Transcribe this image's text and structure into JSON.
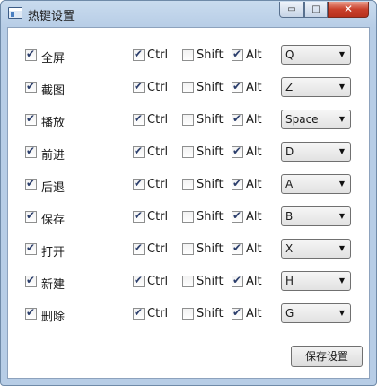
{
  "window": {
    "title": "热键设置",
    "minimize_glyph": "▭",
    "maximize_glyph": "□",
    "close_glyph": "✕"
  },
  "rows": [
    {
      "action": "全屏",
      "action_checked": true,
      "ctrl": true,
      "shift": false,
      "alt": true,
      "key": "Q"
    },
    {
      "action": "截图",
      "action_checked": true,
      "ctrl": true,
      "shift": false,
      "alt": true,
      "key": "Z"
    },
    {
      "action": "播放",
      "action_checked": true,
      "ctrl": true,
      "shift": false,
      "alt": true,
      "key": "Space"
    },
    {
      "action": "前进",
      "action_checked": true,
      "ctrl": true,
      "shift": false,
      "alt": true,
      "key": "D"
    },
    {
      "action": "后退",
      "action_checked": true,
      "ctrl": true,
      "shift": false,
      "alt": true,
      "key": "A"
    },
    {
      "action": "保存",
      "action_checked": true,
      "ctrl": true,
      "shift": false,
      "alt": true,
      "key": "B"
    },
    {
      "action": "打开",
      "action_checked": true,
      "ctrl": true,
      "shift": false,
      "alt": true,
      "key": "X"
    },
    {
      "action": "新建",
      "action_checked": true,
      "ctrl": true,
      "shift": false,
      "alt": true,
      "key": "H"
    },
    {
      "action": "删除",
      "action_checked": true,
      "ctrl": true,
      "shift": false,
      "alt": true,
      "key": "G"
    }
  ],
  "modifiers": {
    "ctrl": "Ctrl",
    "shift": "Shift",
    "alt": "Alt"
  },
  "dropdown_arrow": "▼",
  "save_button": "保存设置"
}
